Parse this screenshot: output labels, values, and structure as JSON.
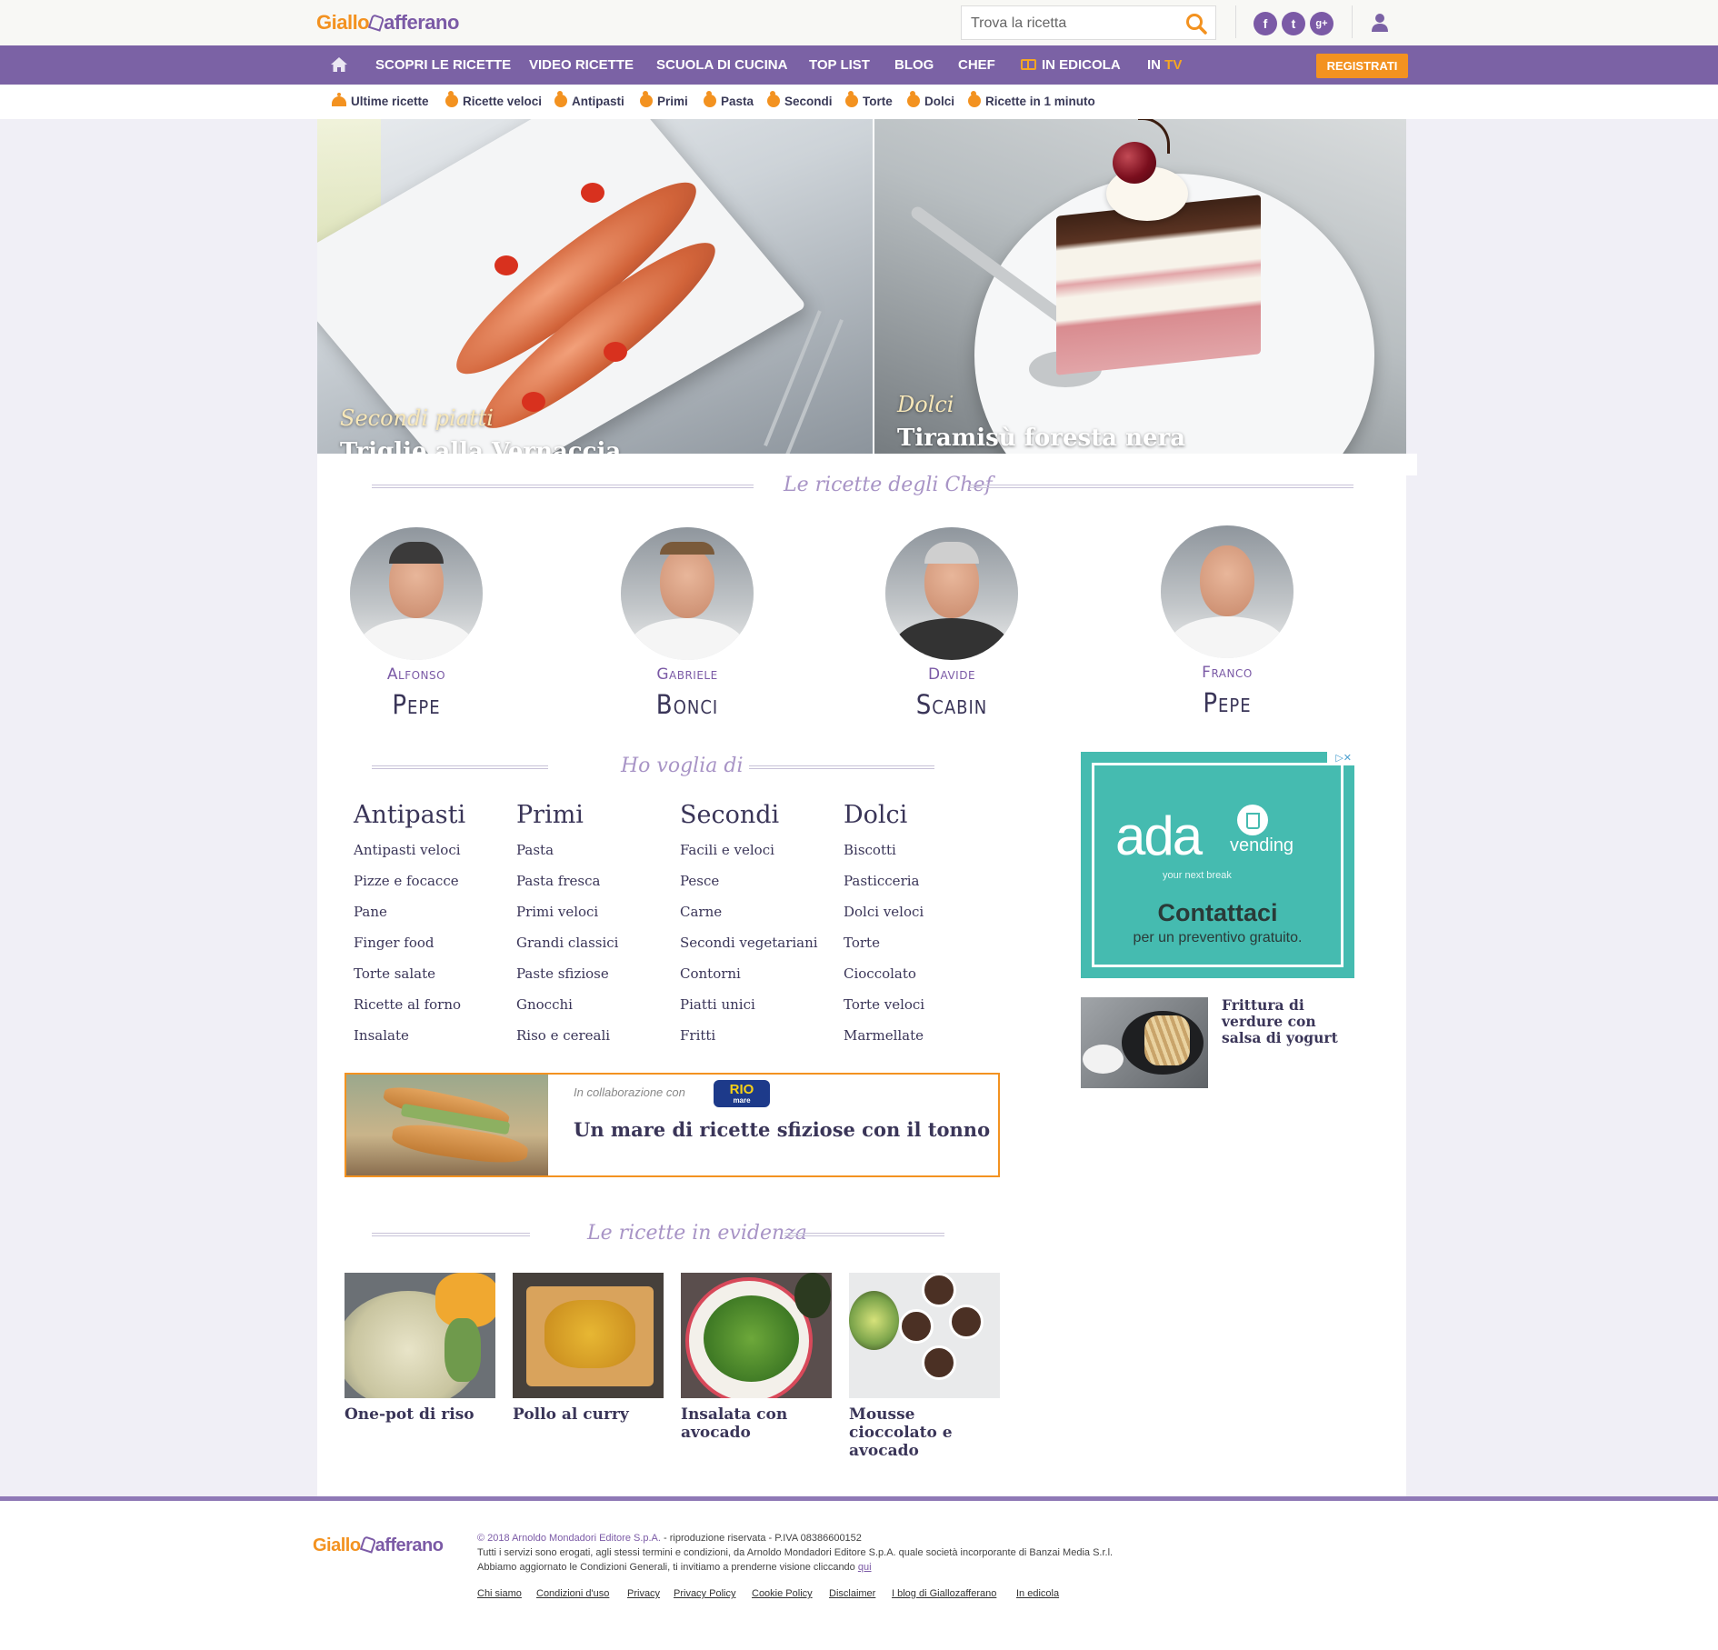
{
  "brand": {
    "logo_part1": "Giallo",
    "logo_part2": "afferano"
  },
  "search": {
    "placeholder": "Trova la ricetta"
  },
  "social": {
    "facebook": "f",
    "twitter": "t",
    "gplus": "g+"
  },
  "icons": {
    "search": "search-icon",
    "user": "user-icon",
    "home": "home-icon",
    "book": "book-icon"
  },
  "colors": {
    "purple": "#7b62a5",
    "orange": "#f39220",
    "ad_teal": "#45bbb0",
    "text_dark": "#3a3558"
  },
  "nav": {
    "items": [
      "SCOPRI LE RICETTE",
      "VIDEO RICETTE",
      "SCUOLA DI CUCINA",
      "TOP LIST",
      "BLOG",
      "CHEF",
      "IN EDICOLA"
    ],
    "in_tv_prefix": "IN ",
    "in_tv_suffix": "TV",
    "register": "REGISTRATI"
  },
  "subnav": {
    "items": [
      "Ultime ricette",
      "Ricette veloci",
      "Antipasti",
      "Primi",
      "Pasta",
      "Secondi",
      "Torte",
      "Dolci",
      "Ricette in 1 minuto"
    ]
  },
  "hero": [
    {
      "category": "Secondi piatti",
      "title": "Triglie alla Vernaccia"
    },
    {
      "category": "Dolci",
      "title": "Tiramisù foresta nera"
    }
  ],
  "chefs_section": {
    "title": "Le ricette degli Chef",
    "chefs": [
      {
        "first": "Alfonso",
        "last": "Pepe"
      },
      {
        "first": "Gabriele",
        "last": "Bonci"
      },
      {
        "first": "Davide",
        "last": "Scabin"
      },
      {
        "first": "Franco",
        "last": "Pepe"
      }
    ]
  },
  "voglia": {
    "title": "Ho voglia di",
    "columns": [
      {
        "title": "Antipasti",
        "links": [
          "Antipasti veloci",
          "Pizze e focacce",
          "Pane",
          "Finger food",
          "Torte salate",
          "Ricette al forno",
          "Insalate"
        ]
      },
      {
        "title": "Primi",
        "links": [
          "Pasta",
          "Pasta fresca",
          "Primi veloci",
          "Grandi classici",
          "Paste sfiziose",
          "Gnocchi",
          "Riso e cereali"
        ]
      },
      {
        "title": "Secondi",
        "links": [
          "Facili e veloci",
          "Pesce",
          "Carne",
          "Secondi vegetariani",
          "Contorni",
          "Piatti unici",
          "Fritti"
        ]
      },
      {
        "title": "Dolci",
        "links": [
          "Biscotti",
          "Pasticceria",
          "Dolci veloci",
          "Torte",
          "Cioccolato",
          "Torte veloci",
          "Marmellate"
        ]
      }
    ]
  },
  "promo": {
    "collab": "In collaborazione con",
    "sponsor": "RIO",
    "sponsor_sub": "mare",
    "title": "Un mare di ricette sfiziose con il tonno"
  },
  "evidenza": {
    "title": "Le ricette in evidenza",
    "items": [
      "One-pot di riso",
      "Pollo al curry",
      "Insalata con avocado",
      "Mousse cioccolato e avocado"
    ]
  },
  "ad": {
    "brand": "ada",
    "brand_suffix": "vending",
    "tagline": "your next break",
    "cta": "Contattaci",
    "sub": "per un preventivo gratuito.",
    "adchoice": "▷✕"
  },
  "sidebar": {
    "recipe_title": "Frittura di verdure con salsa di yogurt"
  },
  "footer": {
    "copyright": "© 2018 Arnoldo Mondadori Editore S.p.A.",
    "copyright_rest": " - riproduzione riservata - P.IVA 08386600152",
    "line2": "Tutti i servizi sono erogati, agli stessi termini e condizioni, da Arnoldo Mondadori Editore S.p.A. quale società incorporante di Banzai Media S.r.l.",
    "line3": "Abbiamo aggiornato le Condizioni Generali, ti invitiamo a prenderne visione cliccando ",
    "line3_link": "qui",
    "links": [
      "Chi siamo",
      "Condizioni d'uso",
      "Privacy",
      "Privacy Policy",
      "Cookie Policy",
      "Disclaimer",
      "I blog di Giallozafferano",
      "In edicola"
    ]
  }
}
